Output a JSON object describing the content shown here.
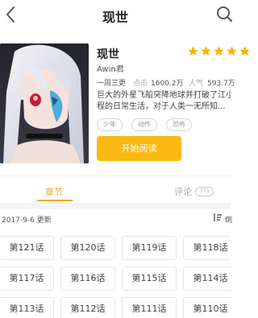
{
  "header": {
    "title": "现世"
  },
  "comic": {
    "name": "现世",
    "rating": 5,
    "author": "Awin君",
    "schedule": "一周三更",
    "clicks_label": "点击",
    "clicks_value": "1600.2万",
    "popularity_label": "人气",
    "popularity_value": "593.7万",
    "description_line1": "巨大的外星飞船突降地球并打破了江小",
    "description_line2": "程的日常生活，对于人类一无所知...",
    "tags": [
      "少年",
      "动作",
      "恐怖"
    ],
    "read_button": "开始阅读"
  },
  "tabs": {
    "chapters": "章节",
    "comments": "评论",
    "comments_count": "373"
  },
  "chapters_meta": {
    "update_text": "2017-9-6 更新",
    "sort_label": "倒"
  },
  "chapters": [
    "第121话",
    "第120话",
    "第119话",
    "第118话",
    "第117话",
    "第116话",
    "第115话",
    "第114话",
    "第113话",
    "第112话",
    "第111话",
    "第110话"
  ],
  "colors": {
    "accent": "#fbb913",
    "tab_active": "#f5a623",
    "star": "#f7b500"
  },
  "icons": {
    "back": "chevron-left-icon",
    "search": "search-icon",
    "star": "star-icon",
    "sort": "sort-icon"
  }
}
